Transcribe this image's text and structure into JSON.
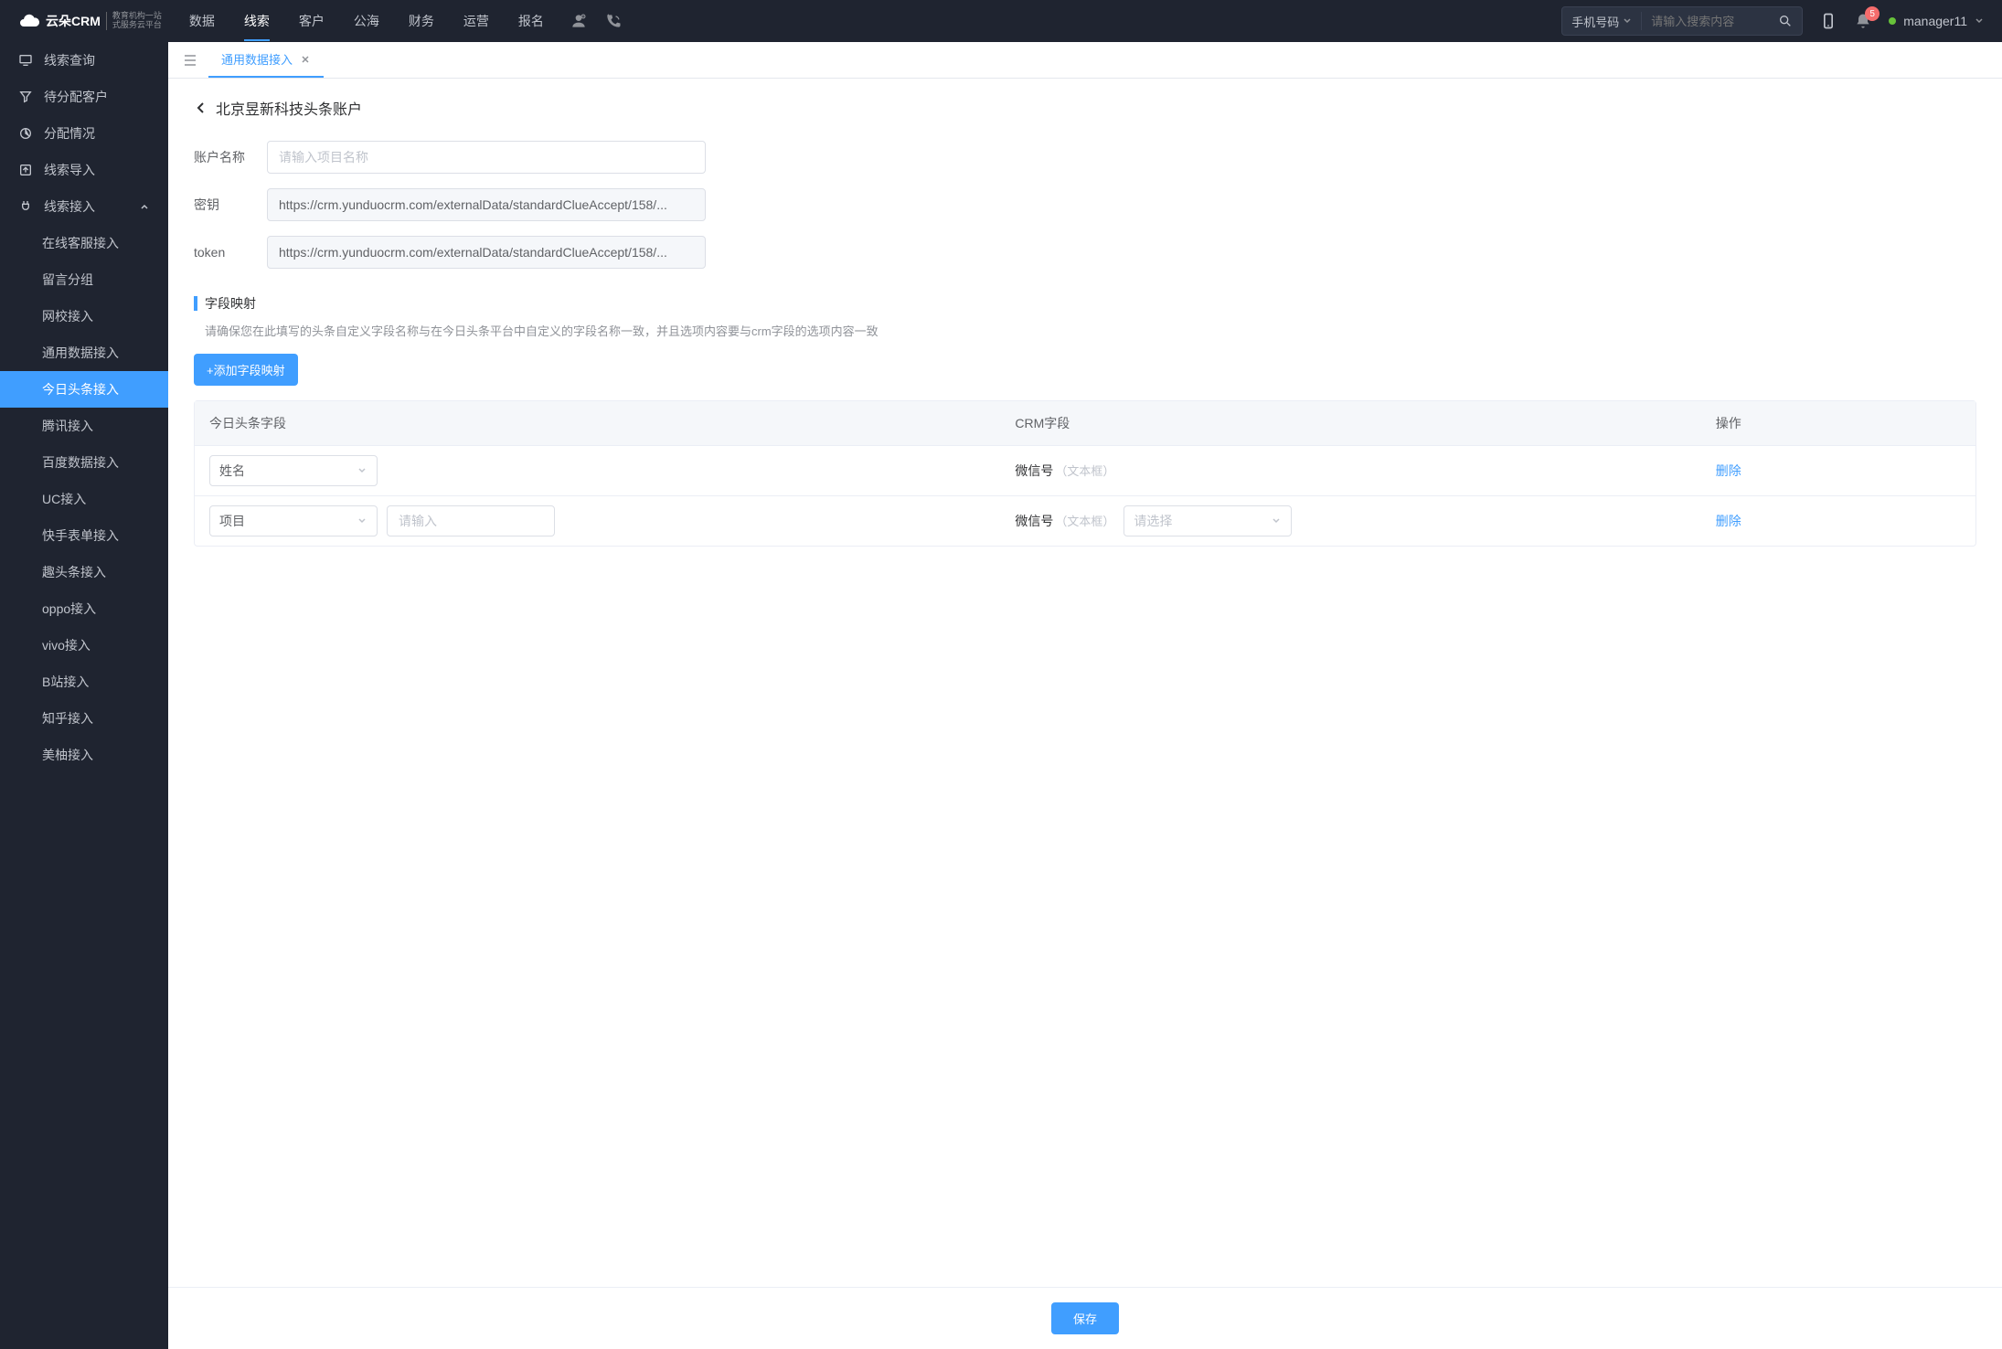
{
  "header": {
    "logo_text": "云朵CRM",
    "logo_sub1": "教育机构一站",
    "logo_sub2": "式服务云平台",
    "nav": [
      "数据",
      "线索",
      "客户",
      "公海",
      "财务",
      "运营",
      "报名"
    ],
    "nav_active": 1,
    "search_type": "手机号码",
    "search_placeholder": "请输入搜索内容",
    "badge_count": "5",
    "user_name": "manager11"
  },
  "sidebar": {
    "top": [
      {
        "icon": "monitor",
        "label": "线索查询"
      },
      {
        "icon": "funnel",
        "label": "待分配客户"
      },
      {
        "icon": "pie",
        "label": "分配情况"
      },
      {
        "icon": "export",
        "label": "线索导入"
      },
      {
        "icon": "plug",
        "label": "线索接入",
        "expand": true
      }
    ],
    "sub": [
      "在线客服接入",
      "留言分组",
      "网校接入",
      "通用数据接入",
      "今日头条接入",
      "腾讯接入",
      "百度数据接入",
      "UC接入",
      "快手表单接入",
      "趣头条接入",
      "oppo接入",
      "vivo接入",
      "B站接入",
      "知乎接入",
      "美柚接入"
    ],
    "sub_active": 4
  },
  "tabs": [
    {
      "label": "通用数据接入",
      "active": true
    }
  ],
  "page": {
    "title": "北京昱新科技头条账户",
    "form": {
      "account_label": "账户名称",
      "account_placeholder": "请输入项目名称",
      "secret_label": "密钥",
      "secret_value": "https://crm.yunduocrm.com/externalData/standardClueAccept/158/...",
      "token_label": "token",
      "token_value": "https://crm.yunduocrm.com/externalData/standardClueAccept/158/..."
    },
    "section_title": "字段映射",
    "section_desc": "请确保您在此填写的头条自定义字段名称与在今日头条平台中自定义的字段名称一致，并且选项内容要与crm字段的选项内容一致",
    "add_btn": "+添加字段映射",
    "table": {
      "headers": [
        "今日头条字段",
        "CRM字段",
        "操作"
      ],
      "rows": [
        {
          "toutiao_select": "姓名",
          "extra_input": false,
          "crm_main": "微信号",
          "crm_sub": "（文本框）",
          "crm_select": null,
          "delete": "删除"
        },
        {
          "toutiao_select": "项目",
          "extra_input": true,
          "extra_placeholder": "请输入",
          "crm_main": "微信号",
          "crm_sub": "（文本框）",
          "crm_select": "请选择",
          "delete": "删除"
        }
      ]
    },
    "save_btn": "保存"
  }
}
